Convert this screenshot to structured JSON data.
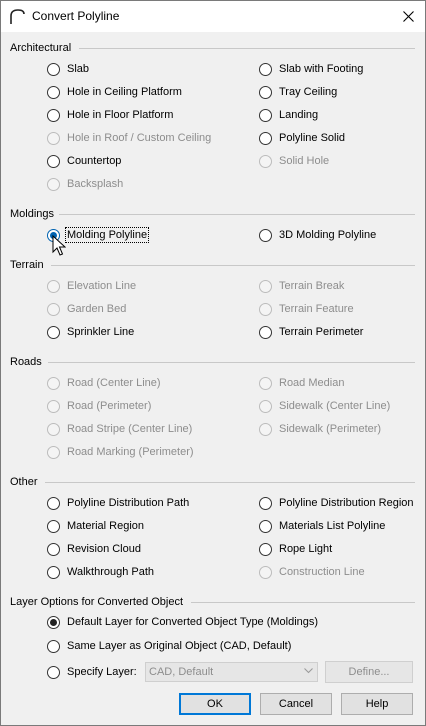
{
  "window": {
    "title": "Convert Polyline"
  },
  "groups": {
    "architectural": {
      "label": "Architectural",
      "left": [
        {
          "label": "Slab",
          "enabled": true
        },
        {
          "label": "Hole in Ceiling Platform",
          "enabled": true
        },
        {
          "label": "Hole in Floor Platform",
          "enabled": true
        },
        {
          "label": "Hole in Roof / Custom Ceiling",
          "enabled": false
        },
        {
          "label": "Countertop",
          "enabled": true
        },
        {
          "label": "Backsplash",
          "enabled": false
        }
      ],
      "right": [
        {
          "label": "Slab with Footing",
          "enabled": true
        },
        {
          "label": "Tray Ceiling",
          "enabled": true
        },
        {
          "label": "Landing",
          "enabled": true
        },
        {
          "label": "Polyline Solid",
          "enabled": true
        },
        {
          "label": "Solid Hole",
          "enabled": false
        }
      ]
    },
    "moldings": {
      "label": "Moldings",
      "left": [
        {
          "label": "Molding Polyline",
          "enabled": true,
          "checked": true
        }
      ],
      "right": [
        {
          "label": "3D Molding Polyline",
          "enabled": true
        }
      ]
    },
    "terrain": {
      "label": "Terrain",
      "left": [
        {
          "label": "Elevation Line",
          "enabled": false
        },
        {
          "label": "Garden Bed",
          "enabled": false
        },
        {
          "label": "Sprinkler Line",
          "enabled": true
        }
      ],
      "right": [
        {
          "label": "Terrain Break",
          "enabled": false
        },
        {
          "label": "Terrain Feature",
          "enabled": false
        },
        {
          "label": "Terrain Perimeter",
          "enabled": true
        }
      ]
    },
    "roads": {
      "label": "Roads",
      "left": [
        {
          "label": "Road (Center Line)",
          "enabled": false
        },
        {
          "label": "Road (Perimeter)",
          "enabled": false
        },
        {
          "label": "Road Stripe (Center Line)",
          "enabled": false
        },
        {
          "label": "Road Marking (Perimeter)",
          "enabled": false
        }
      ],
      "right": [
        {
          "label": "Road Median",
          "enabled": false
        },
        {
          "label": "Sidewalk (Center Line)",
          "enabled": false
        },
        {
          "label": "Sidewalk (Perimeter)",
          "enabled": false
        }
      ]
    },
    "other": {
      "label": "Other",
      "left": [
        {
          "label": "Polyline Distribution Path",
          "enabled": true
        },
        {
          "label": "Material Region",
          "enabled": true
        },
        {
          "label": "Revision Cloud",
          "enabled": true
        },
        {
          "label": "Walkthrough Path",
          "enabled": true
        }
      ],
      "right": [
        {
          "label": "Polyline Distribution Region",
          "enabled": true
        },
        {
          "label": "Materials List Polyline",
          "enabled": true
        },
        {
          "label": "Rope Light",
          "enabled": true
        },
        {
          "label": "Construction Line",
          "enabled": false
        }
      ]
    }
  },
  "layer_options": {
    "label": "Layer Options for Converted Object",
    "default_layer": "Default Layer for Converted Object Type (Moldings)",
    "same_layer": "Same Layer as Original Object (CAD,  Default)",
    "specify_layer": "Specify Layer:",
    "layer_combo_value": "CAD,  Default",
    "define_label": "Define..."
  },
  "buttons": {
    "ok": "OK",
    "cancel": "Cancel",
    "help": "Help"
  }
}
